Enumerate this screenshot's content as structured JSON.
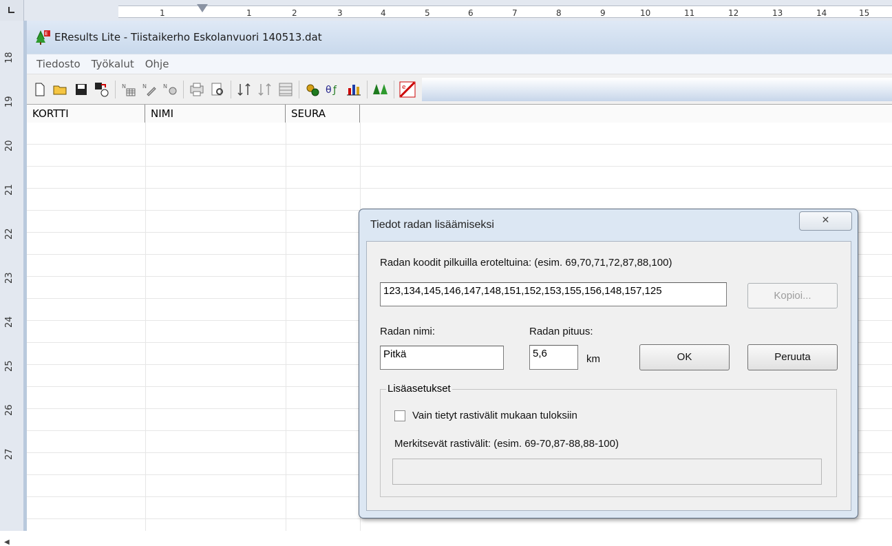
{
  "ruler": {
    "h_numbers": [
      "1",
      "1",
      "2",
      "3",
      "4",
      "5",
      "6",
      "7",
      "8",
      "9",
      "10",
      "11",
      "12",
      "13",
      "14",
      "15"
    ],
    "v_numbers": [
      "18",
      "19",
      "20",
      "21",
      "22",
      "23",
      "24",
      "25",
      "26",
      "27"
    ]
  },
  "window": {
    "title": "EResults Lite - Tiistaikerho Eskolanvuori 140513.dat"
  },
  "menu": {
    "items": [
      "Tiedosto",
      "Työkalut",
      "Ohje"
    ]
  },
  "toolbar": {
    "icons": [
      "new-file-icon",
      "open-folder-icon",
      "save-icon",
      "save-db-icon",
      "result-table-icon",
      "result-edit-icon",
      "result-circle-icon",
      "print-icon",
      "preview-icon",
      "sort-icon",
      "sort-alt-icon",
      "grid-icon",
      "gears-icon",
      "formula-icon",
      "bar-chart-icon",
      "trees-icon",
      "eresults-icon"
    ]
  },
  "table": {
    "columns": [
      "KORTTI",
      "NIMI",
      "SEURA"
    ]
  },
  "dialog": {
    "title": "Tiedot radan lisäämiseksi",
    "close_label": "✕",
    "codes_label": "Radan koodit pilkuilla eroteltuina: (esim. 69,70,71,72,87,88,100)",
    "codes_value": "123,134,145,146,147,148,151,152,153,155,156,148,157,125",
    "copy_label": "Kopioi...",
    "name_label": "Radan nimi:",
    "name_value": "Pitkä",
    "length_label": "Radan pituus:",
    "length_value": "5,6",
    "length_unit": "km",
    "ok_label": "OK",
    "cancel_label": "Peruuta",
    "group_title": "Lisäasetukset",
    "checkbox_label": "Vain tietyt rastivälit mukaan tuloksiin",
    "checkbox_checked": false,
    "legs_label": "Merkitsevät rastivälit: (esim. 69-70,87-88,88-100)",
    "legs_value": ""
  },
  "colors": {
    "dialog_frame": "#dce7f3",
    "title_gradient_top": "#dfe9f6",
    "title_gradient_bottom": "#c9d9ec"
  }
}
